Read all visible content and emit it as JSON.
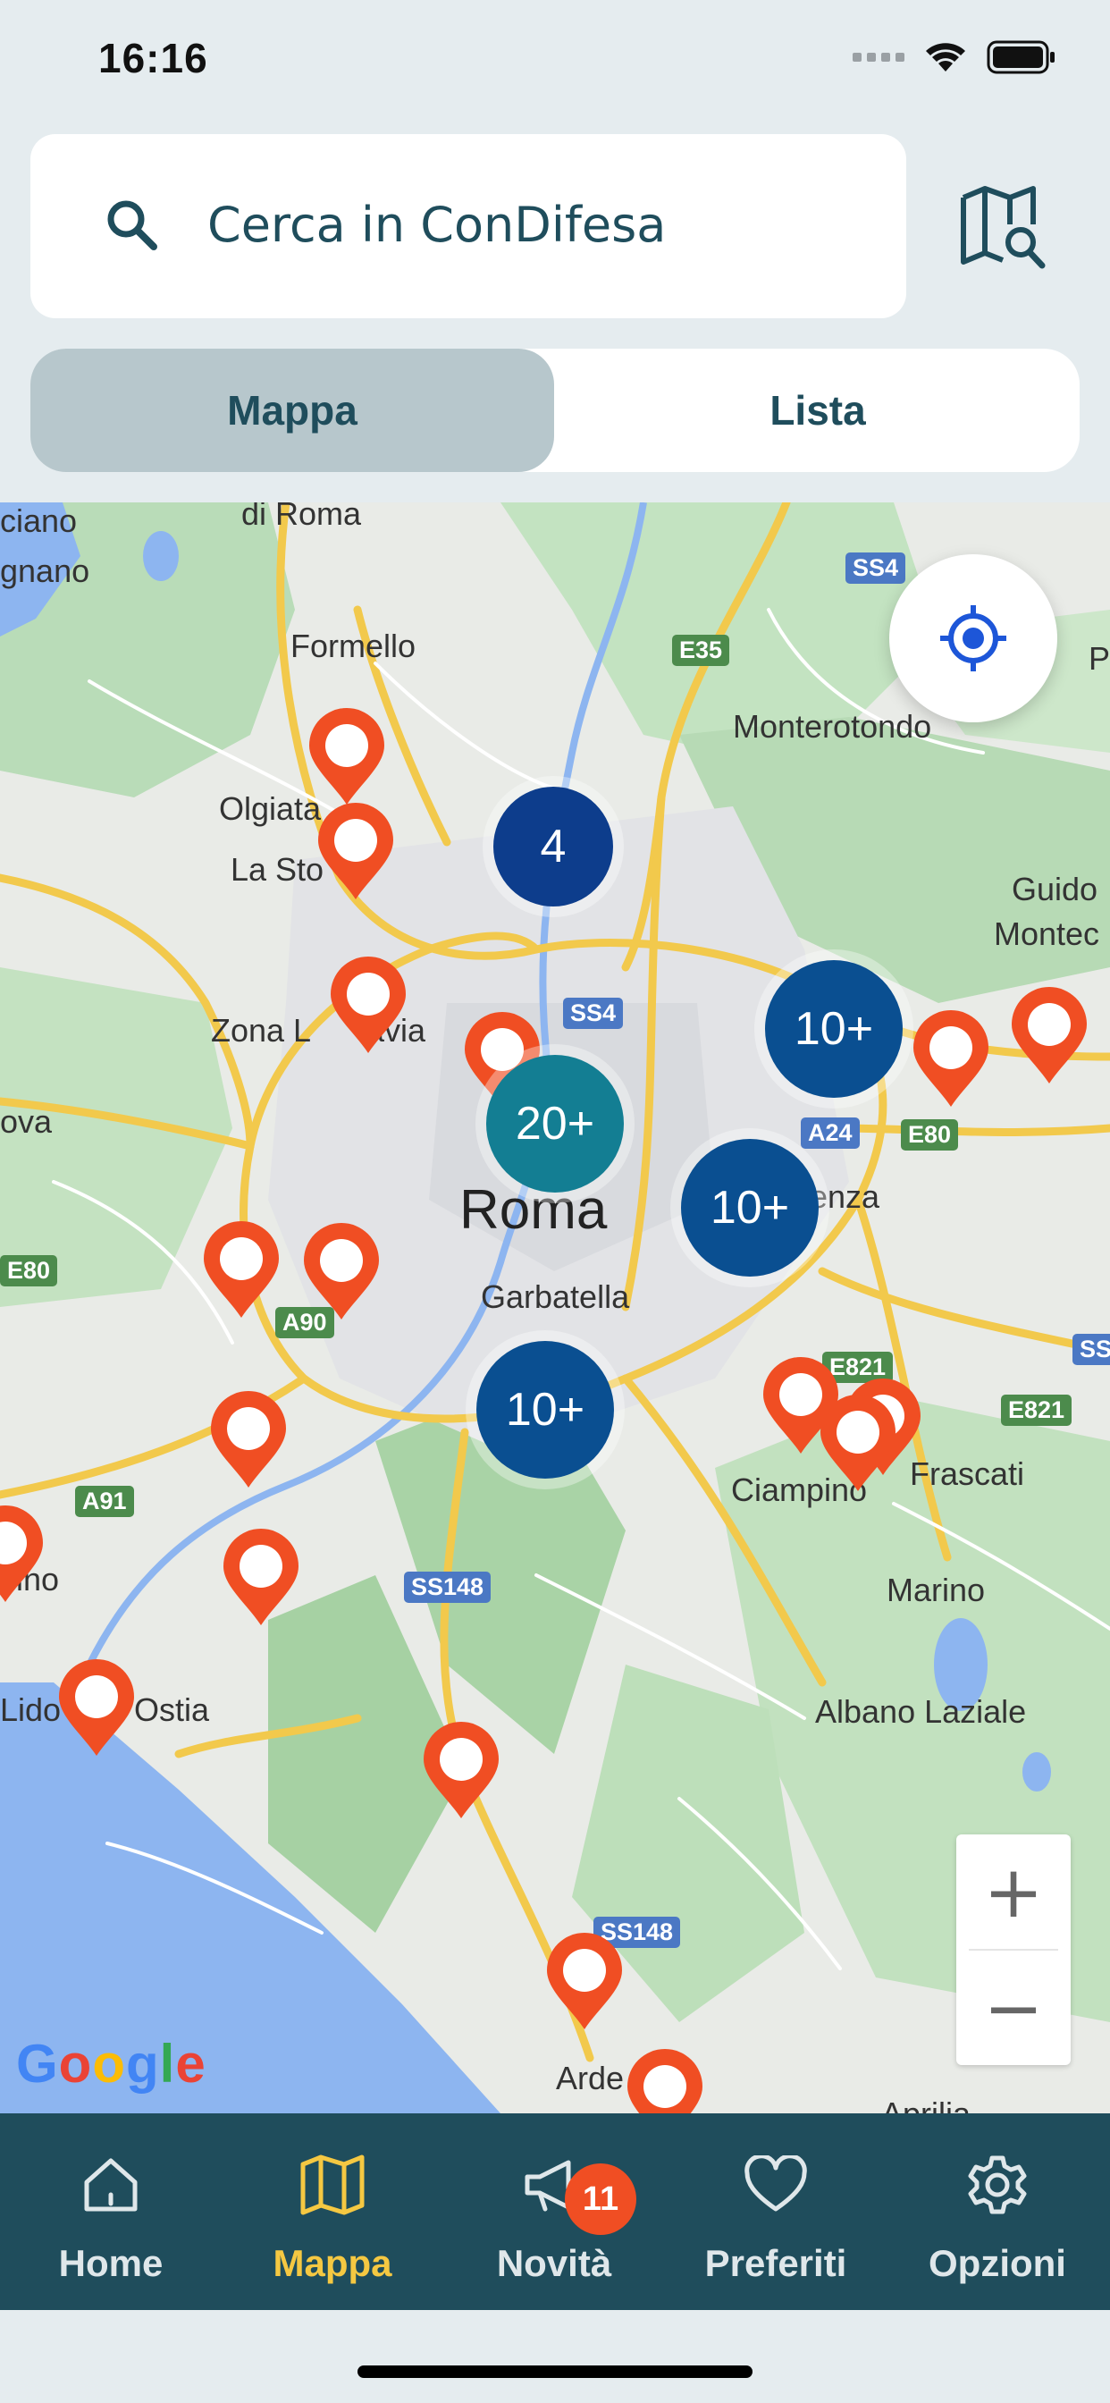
{
  "status_bar": {
    "time": "16:16"
  },
  "search": {
    "placeholder": "Cerca in ConDifesa",
    "map_search_icon": "map-search-icon"
  },
  "segment": {
    "map_label": "Mappa",
    "list_label": "Lista",
    "selected": "Mappa"
  },
  "map": {
    "places": [
      "di Roma",
      "ciano",
      "gnano",
      "Formello",
      "Olgiata",
      "La Sto",
      "Monterotondo",
      "Guido",
      "Montec",
      "P",
      "Zona L",
      "avia",
      "ova",
      "Roma",
      "enza",
      "Garbatella",
      "Ciampino",
      "Frascati",
      "Marino",
      "Albano Laziale",
      "Lido",
      "Ostia",
      "cino",
      "Arde",
      "Aprilia"
    ],
    "roads": [
      "SS4",
      "E35",
      "SS4",
      "A24",
      "E80",
      "E80",
      "A90",
      "E821",
      "E821",
      "SS",
      "A91",
      "SS148",
      "SS148"
    ],
    "clusters": [
      "4",
      "10+",
      "20+",
      "10+",
      "10+"
    ],
    "zoom_in": "+",
    "zoom_out": "−",
    "attribution": "Google"
  },
  "tabs": [
    {
      "label": "Home",
      "icon": "home-icon"
    },
    {
      "label": "Mappa",
      "icon": "map-icon"
    },
    {
      "label": "Novità",
      "icon": "megaphone-icon",
      "badge": "11"
    },
    {
      "label": "Preferiti",
      "icon": "heart-icon"
    },
    {
      "label": "Opzioni",
      "icon": "gear-icon"
    }
  ],
  "active_tab": "Mappa",
  "colors": {
    "primary": "#1f4d5c",
    "accent": "#f5c842",
    "pin": "#f04e23",
    "cluster_navy": "#0d3d8c",
    "cluster_teal": "#137e93"
  }
}
